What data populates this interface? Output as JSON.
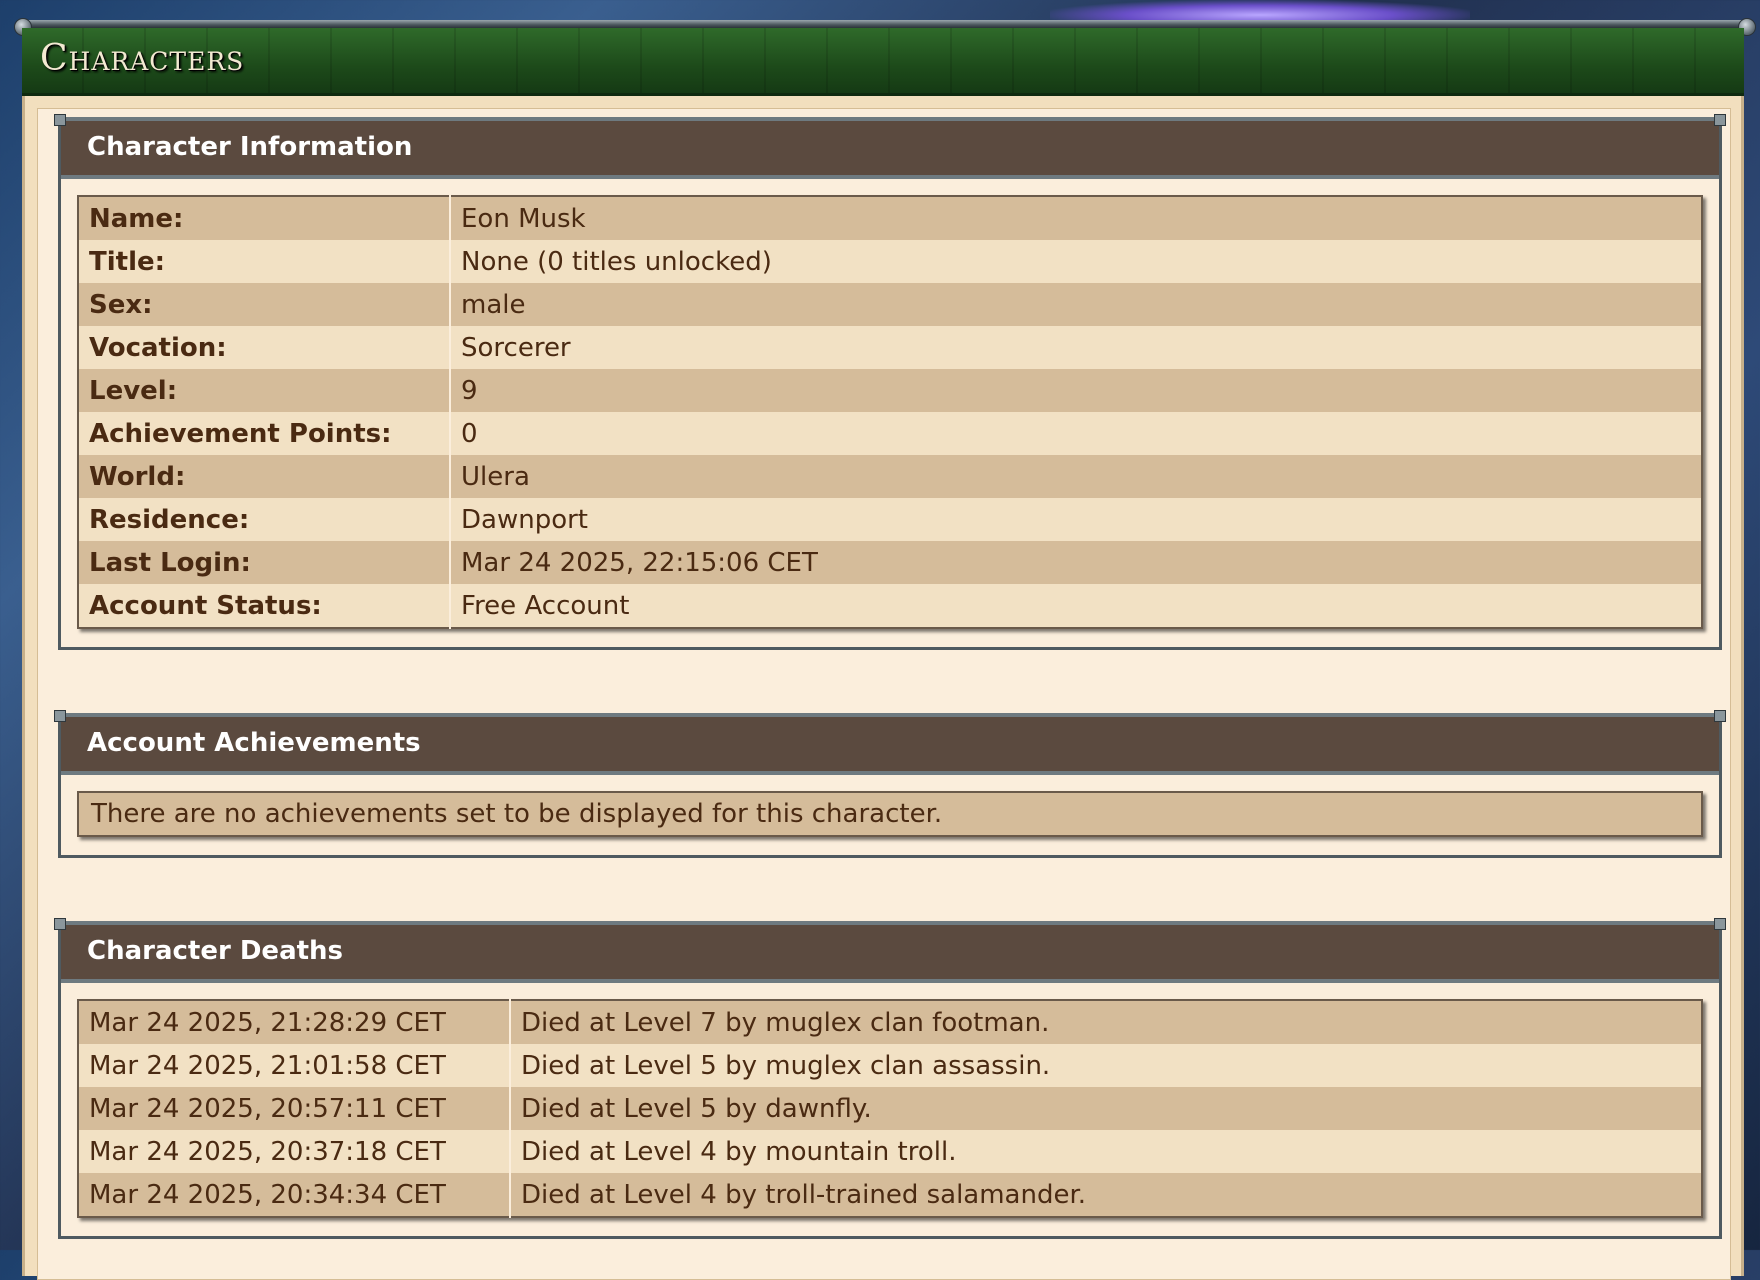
{
  "page": {
    "title": "Characters"
  },
  "character_information": {
    "heading": "Character Information",
    "rows": [
      {
        "label": "Name:",
        "value": "Eon Musk"
      },
      {
        "label": "Title:",
        "value": "None (0 titles unlocked)"
      },
      {
        "label": "Sex:",
        "value": "male"
      },
      {
        "label": "Vocation:",
        "value": "Sorcerer"
      },
      {
        "label": "Level:",
        "value": "9"
      },
      {
        "label": "Achievement Points:",
        "value": "0"
      },
      {
        "label": "World:",
        "value": "Ulera"
      },
      {
        "label": "Residence:",
        "value": "Dawnport"
      },
      {
        "label": "Last Login:",
        "value": "Mar 24 2025, 22:15:06 CET"
      },
      {
        "label": "Account Status:",
        "value": "Free Account"
      }
    ]
  },
  "account_achievements": {
    "heading": "Account Achievements",
    "message": "There are no achievements set to be displayed for this character."
  },
  "character_deaths": {
    "heading": "Character Deaths",
    "rows": [
      {
        "date": "Mar 24 2025, 21:28:29 CET",
        "description": "Died at Level 7 by muglex clan footman."
      },
      {
        "date": "Mar 24 2025, 21:01:58 CET",
        "description": "Died at Level 5 by muglex clan assassin."
      },
      {
        "date": "Mar 24 2025, 20:57:11 CET",
        "description": "Died at Level 5 by dawnfly."
      },
      {
        "date": "Mar 24 2025, 20:37:18 CET",
        "description": "Died at Level 4 by mountain troll."
      },
      {
        "date": "Mar 24 2025, 20:34:34 CET",
        "description": "Died at Level 4 by troll-trained salamander."
      }
    ]
  }
}
